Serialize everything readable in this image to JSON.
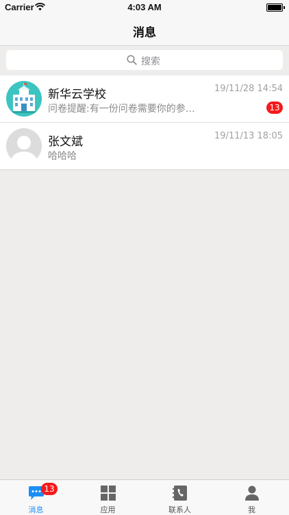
{
  "status_bar": {
    "carrier": "Carrier",
    "time": "4:03 AM"
  },
  "navbar": {
    "title": "消息"
  },
  "search": {
    "placeholder": "搜索"
  },
  "conversations": [
    {
      "name": "新华云学校",
      "preview": "问卷提醒:有一份问卷需要你的参…",
      "timestamp": "19/11/28 14:54",
      "unread": "13",
      "avatar": "school-avatar"
    },
    {
      "name": "张文斌",
      "preview": "哈哈哈",
      "timestamp": "19/11/13 18:05",
      "avatar": "default-user-avatar"
    }
  ],
  "tabbar": {
    "items": [
      {
        "label": "消息",
        "icon": "chat-bubble-icon",
        "badge": "13",
        "active": true
      },
      {
        "label": "应用",
        "icon": "grid-icon"
      },
      {
        "label": "联系人",
        "icon": "contacts-book-icon"
      },
      {
        "label": "我",
        "icon": "person-icon"
      }
    ]
  },
  "colors": {
    "accent": "#1a8ef5",
    "badge": "#f51a1a",
    "background": "#efedec"
  }
}
